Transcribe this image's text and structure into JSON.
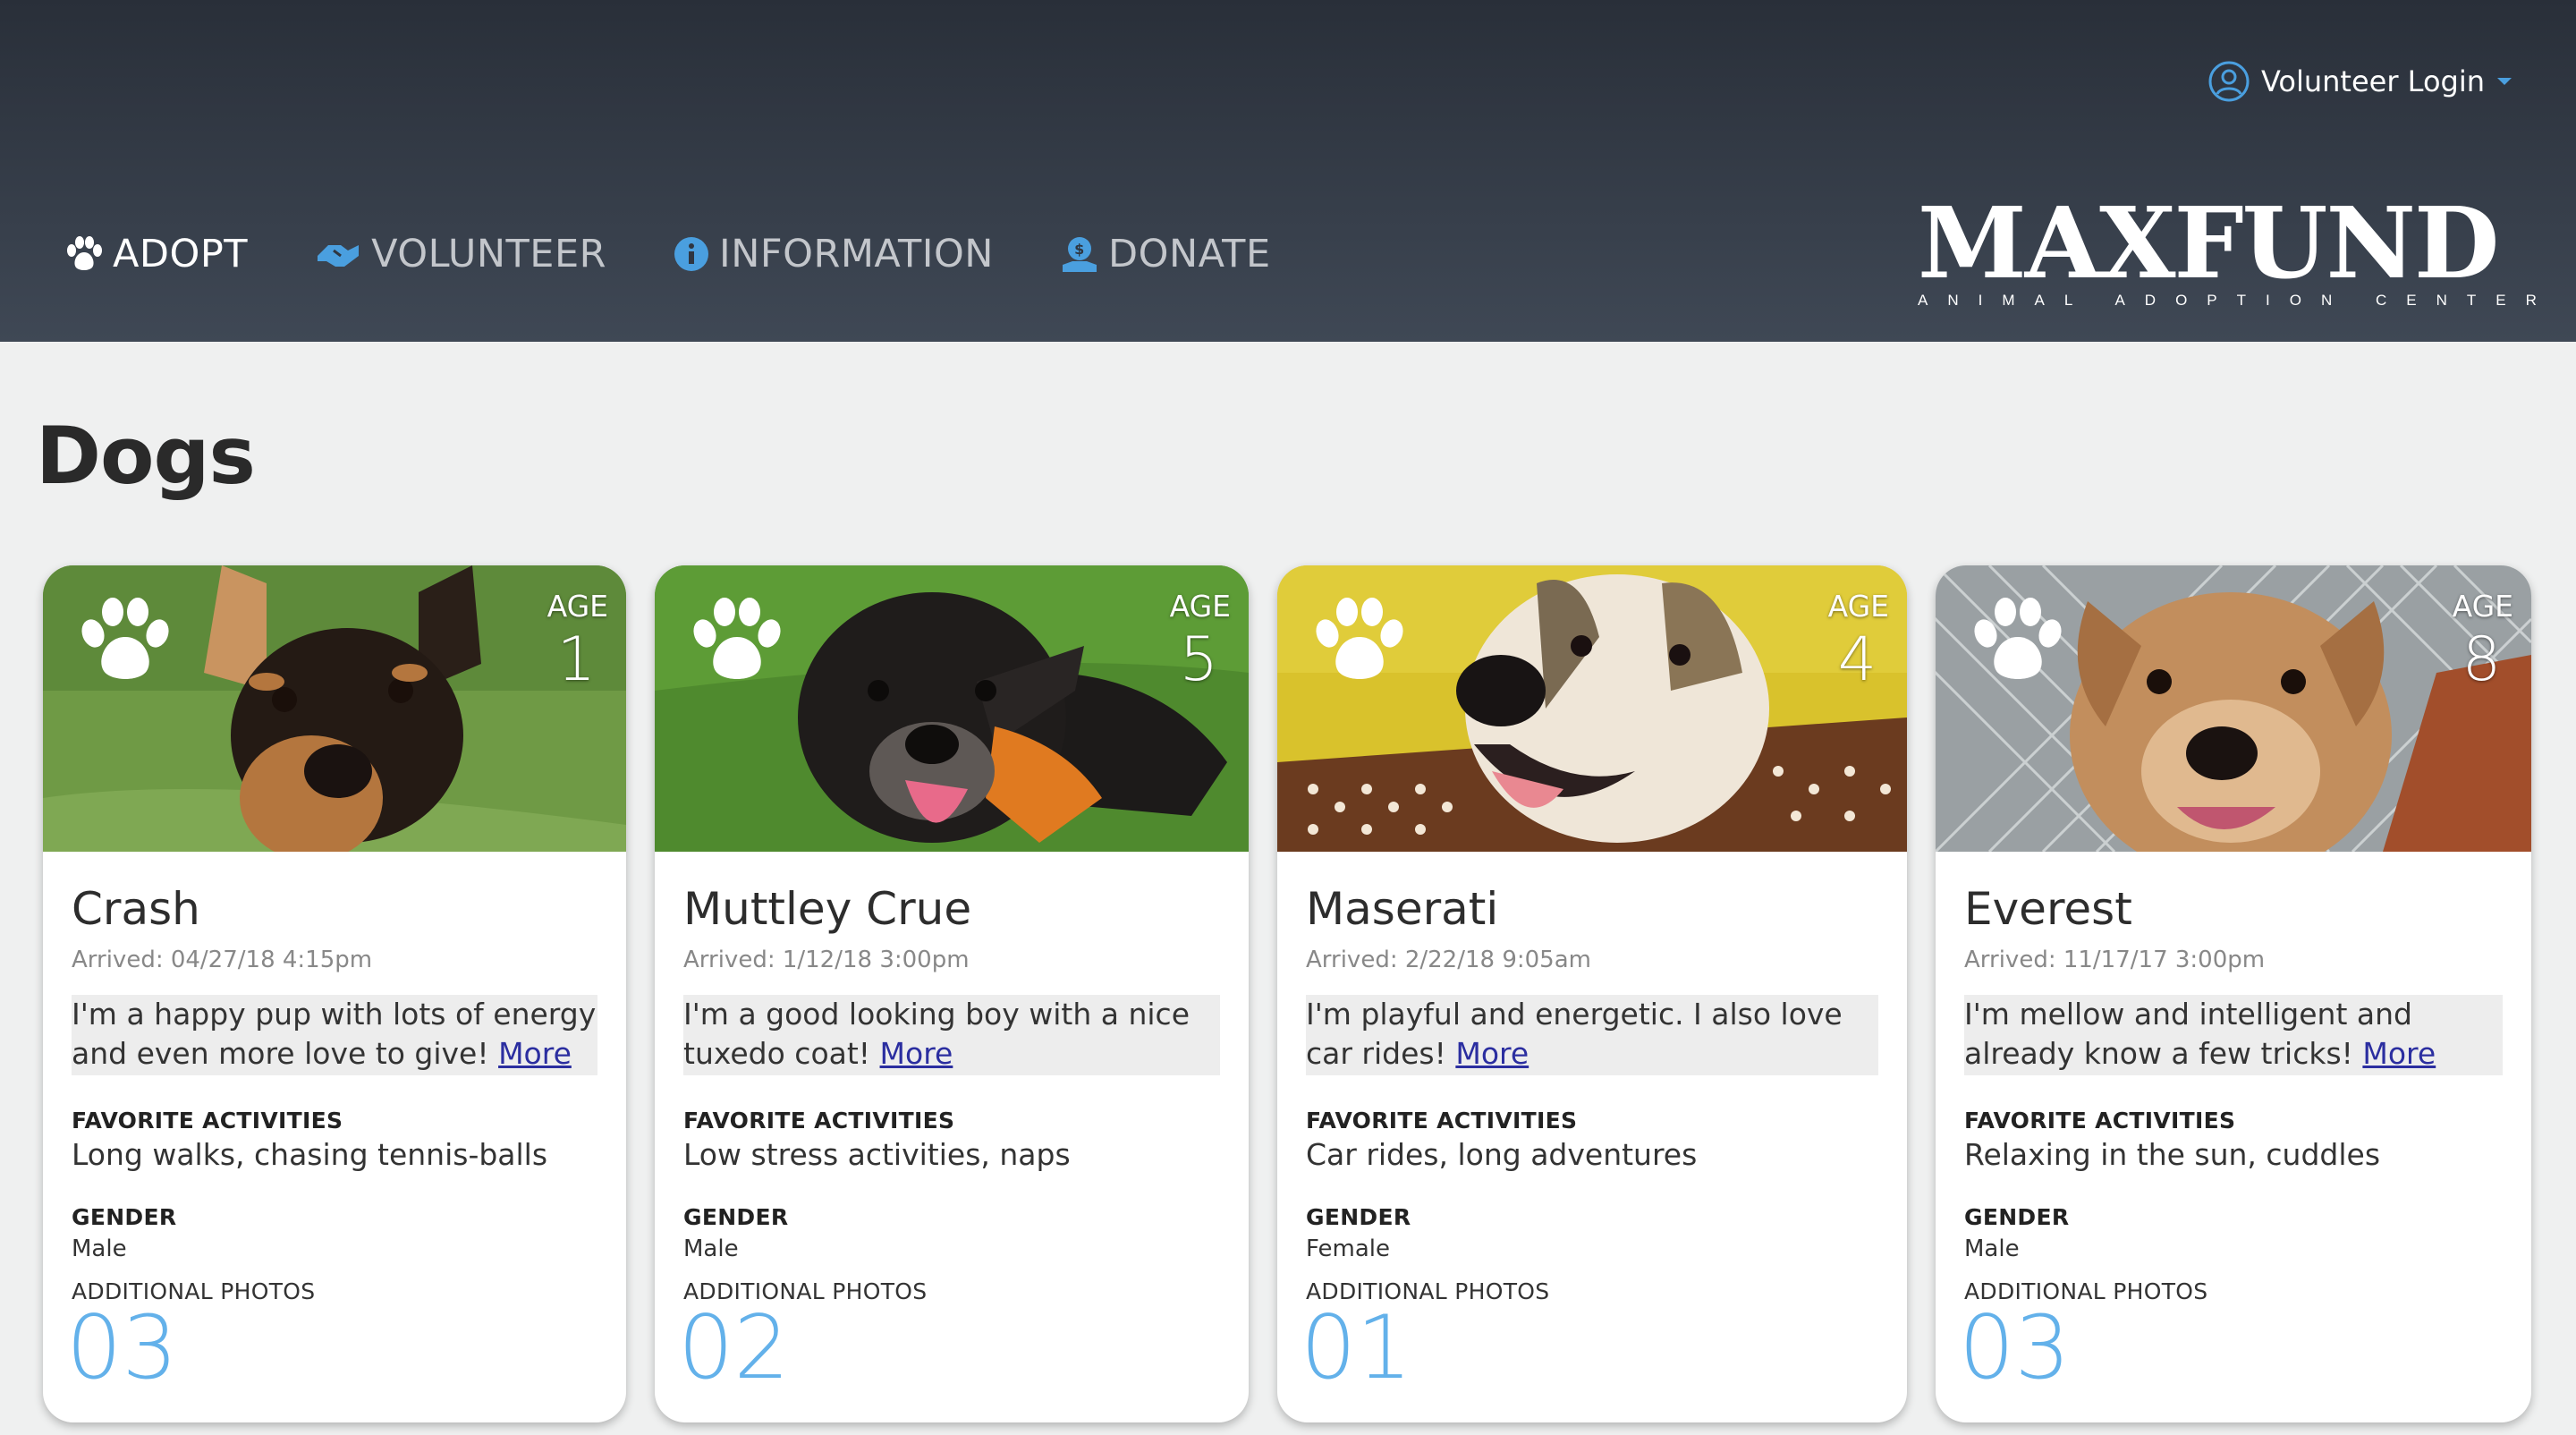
{
  "header": {
    "login_label": "Volunteer Login",
    "nav": [
      {
        "label": "ADOPT",
        "icon": "paw-icon",
        "active": true
      },
      {
        "label": "VOLUNTEER",
        "icon": "handshake-icon",
        "active": false
      },
      {
        "label": "INFORMATION",
        "icon": "info-icon",
        "active": false
      },
      {
        "label": "DONATE",
        "icon": "donate-icon",
        "active": false
      }
    ],
    "logo_main": "MAXFUND",
    "logo_sub": "ANIMAL ADOPTION CENTER"
  },
  "page": {
    "title": "Dogs"
  },
  "labels": {
    "age": "AGE",
    "favorite": "FAVORITE ACTIVITIES",
    "gender": "GENDER",
    "photos": "ADDITIONAL PHOTOS",
    "more": "More"
  },
  "dogs": [
    {
      "age": "1",
      "name": "Crash",
      "arrived": "Arrived: 04/27/18 4:15pm",
      "description": "I'm a happy pup with lots of energy and even more love to give!",
      "favorite": "Long walks, chasing tennis-balls",
      "gender": "Male",
      "photos": "03"
    },
    {
      "age": "5",
      "name": "Muttley Crue",
      "arrived": "Arrived: 1/12/18 3:00pm",
      "description": "I'm a good looking boy with a nice tuxedo coat!",
      "favorite": "Low stress activities, naps",
      "gender": "Male",
      "photos": "02"
    },
    {
      "age": "4",
      "name": "Maserati",
      "arrived": "Arrived: 2/22/18 9:05am",
      "description": "I'm playful and energetic. I also love car rides!",
      "favorite": "Car rides, long adventures",
      "gender": "Female",
      "photos": "01"
    },
    {
      "age": "8",
      "name": "Everest",
      "arrived": "Arrived: 11/17/17 3:00pm",
      "description": "I'm mellow and intelligent and already know a few tricks!",
      "favorite": "Relaxing in the sun, cuddles",
      "gender": "Male",
      "photos": "03"
    }
  ],
  "colors": {
    "header_dark": "#292f39",
    "header_light": "#3f4855",
    "accent_blue": "#63b1ea",
    "link": "#2b2ea0",
    "background": "#eff0f0"
  }
}
